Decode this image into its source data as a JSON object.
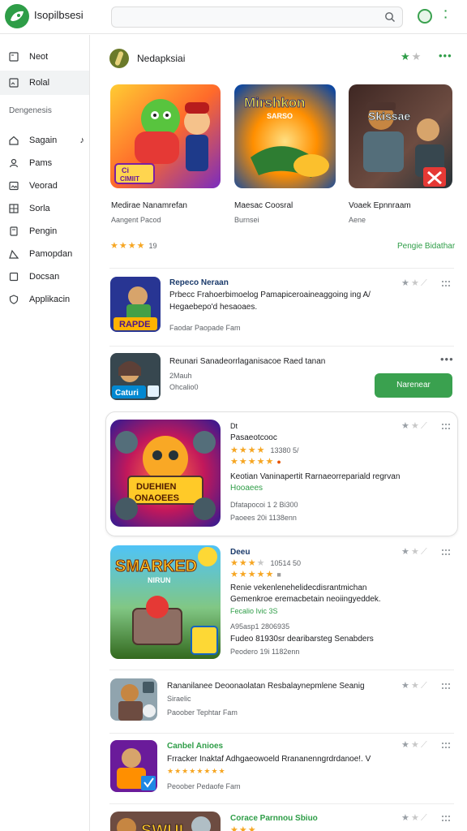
{
  "app": {
    "title": "Isopilbsesi",
    "accent": "#2e9d47"
  },
  "search": {
    "value": "",
    "placeholder": ""
  },
  "sidebar": {
    "items": [
      {
        "label": "Neot",
        "icon": "square-icon"
      },
      {
        "label": "Rolal",
        "icon": "image-icon"
      }
    ],
    "section": "Dengenesis",
    "sub_items": [
      {
        "label": "Sagain",
        "icon": "home-icon",
        "note": "♪"
      },
      {
        "label": "Pams",
        "icon": "user-icon"
      },
      {
        "label": "Veorad",
        "icon": "image-icon"
      },
      {
        "label": "Sorla",
        "icon": "grid-icon"
      },
      {
        "label": "Pengin",
        "icon": "document-icon"
      },
      {
        "label": "Pamopdan",
        "icon": "tag-icon"
      },
      {
        "label": "Docsan",
        "icon": "box-icon"
      },
      {
        "label": "Applikacin",
        "icon": "shield-icon"
      }
    ]
  },
  "featured": {
    "title": "Nedapksiai",
    "cards": [
      {
        "name": "Medirae Nanamrefan",
        "sub": "Aangent Pacod",
        "image_text": "Ci",
        "image_text2": "CIMIIT"
      },
      {
        "name": "Maesac Coosral",
        "sub": "Burnsei",
        "image_text": "Mirshkon",
        "image_text2": "SARSO"
      },
      {
        "name": "Voaek Epnnraam",
        "sub": "Aene",
        "image_text": "Skissae",
        "image_text2": ""
      }
    ],
    "rating_count": "19",
    "see_more": "Pengie Bidathar"
  },
  "list": [
    {
      "title": "Repeco Neraan",
      "desc": [
        "Prbecc Frahoerbimoelog Pamapiceroaineaggoing ing A/",
        "Hegaebepo'd hesaoaes."
      ],
      "meta": "Faodar Paopade Fam",
      "image_text": "RAPDE"
    },
    {
      "title": "Reunari Sanadeorrlaganisacoe Raed tanan",
      "meta1": "2Mauh",
      "meta2": "Ohcalio0",
      "button": "Narenear",
      "image_text": "Caturi"
    },
    {
      "tag": "Dt",
      "title": "Pasaeotcooc",
      "rating1_text": "13380 5/",
      "rating2_text": "",
      "desc": "Keotian Vaninapertit Rarnaeorrepariald regrvan",
      "desc_green": "Hooaees",
      "meta1": "Dfatapocoi 1 2 Bi300",
      "meta2": "Paoees 20i 1138enn",
      "image_text": "DUEHIEN",
      "image_text2": "ONAOEES"
    },
    {
      "title": "Deeu",
      "rating1_text": "10514 50",
      "desc": [
        "Renie vekenlenehelidecdisrantmichan",
        "Gemenkroe eremacbetain neoiingyeddek."
      ],
      "desc_green": "Fecalio Ivic 3S",
      "meta1": "A95asp1 2806935",
      "meta2": "Fudeo 81930sr dearibarsteg Senabders",
      "meta3": "Peodero 19i 1182enn",
      "image_text": "SMARKED",
      "image_text2": "NIRUN"
    },
    {
      "title": "Rananilanee Deoonaolatan Resbalaynepmlene Seanig",
      "meta1": "Siraelic",
      "meta2": "Paoober Tephtar Fam",
      "image_text": ""
    },
    {
      "title": "Canbel Anioes",
      "desc": "Frracker Inaktaf Adhgaeowoeld Rrananenngrdrdanoe!. V",
      "meta2": "Peoober Pedaofe Fam",
      "image_text": ""
    },
    {
      "title": "Corace Parnnou Sbiuo",
      "image_text": "SWUI"
    }
  ]
}
